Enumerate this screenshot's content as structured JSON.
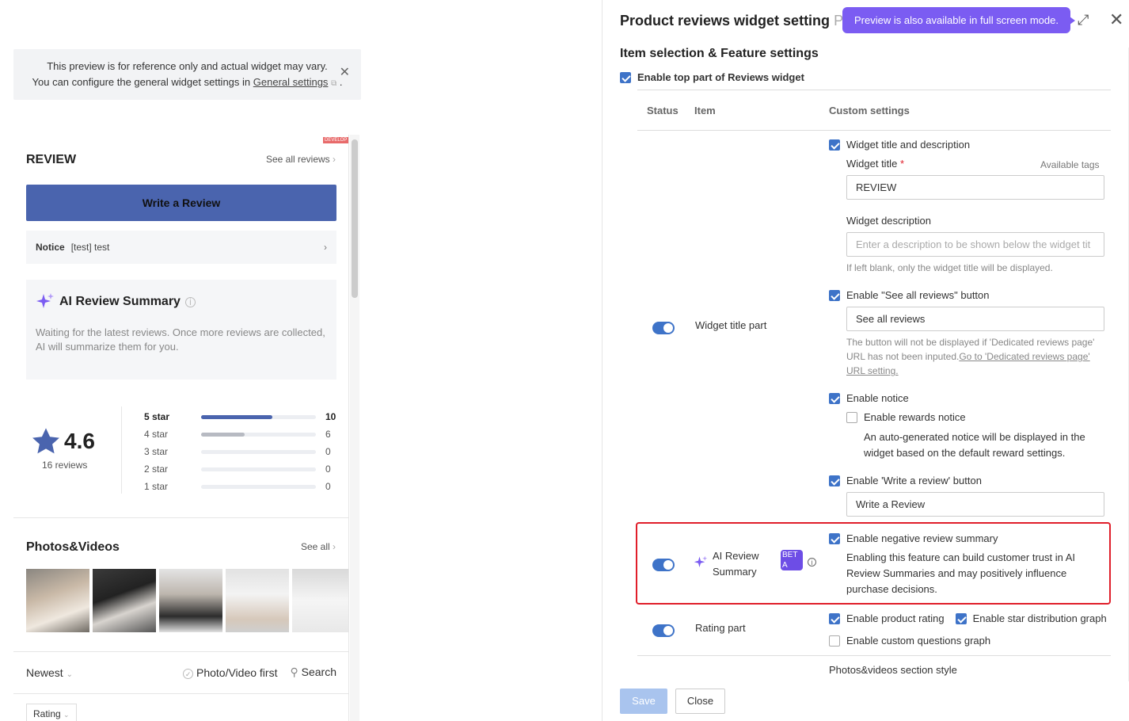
{
  "preview": {
    "notice_line1": "This preview is for reference only and actual widget may vary.",
    "notice_line2": "You can configure the general widget settings in",
    "notice_link": "General settings",
    "notice_end": ".",
    "dev_badge": "DEVELOP"
  },
  "widget": {
    "title": "REVIEW",
    "see_all": "See all reviews",
    "write_button": "Write a Review",
    "notice_label": "Notice",
    "notice_text": "[test] test",
    "ai_title": "AI Review Summary",
    "ai_text": "Waiting for the latest reviews. Once more reviews are collected, AI will summarize them for you.",
    "rating": "4.6",
    "reviews_count": "16 reviews",
    "distribution": [
      {
        "label": "5 star",
        "count": "10",
        "fraction": 0.62,
        "color": "#4a64ae",
        "bold": true
      },
      {
        "label": "4 star",
        "count": "6",
        "fraction": 0.38,
        "color": "#b7bac2",
        "bold": false
      },
      {
        "label": "3 star",
        "count": "0",
        "fraction": 0,
        "color": "#b7bac2",
        "bold": false
      },
      {
        "label": "2 star",
        "count": "0",
        "fraction": 0,
        "color": "#b7bac2",
        "bold": false
      },
      {
        "label": "1 star",
        "count": "0",
        "fraction": 0,
        "color": "#b7bac2",
        "bold": false
      }
    ],
    "photos_title": "Photos&Videos",
    "photos_see_all": "See all",
    "sort_label": "Newest",
    "photo_first": "Photo/Video first",
    "search": "Search",
    "rating_filter": "Rating"
  },
  "settings": {
    "title": "Product reviews widget setting",
    "tooltip": "Preview is also available in full screen mode.",
    "section_title": "Item selection & Feature settings",
    "enable_top": "Enable top part of Reviews widget",
    "col_status": "Status",
    "col_item": "Item",
    "col_custom": "Custom settings",
    "title_part": {
      "label": "Widget title part",
      "title_desc_chk": "Widget title and description",
      "widget_title_label": "Widget title",
      "required": "*",
      "available_tags": "Available tags",
      "widget_title_value": "REVIEW",
      "widget_desc_label": "Widget description",
      "widget_desc_placeholder": "Enter a description to be shown below the widget tit",
      "desc_hint": "If left blank, only the widget title will be displayed.",
      "see_all_chk": "Enable \"See all reviews\" button",
      "see_all_value": "See all reviews",
      "see_all_hint1": "The button will not be displayed if 'Dedicated reviews page'",
      "see_all_hint2": "URL has not been inputed.",
      "see_all_link1": "Go to 'Dedicated reviews page'",
      "see_all_link2": "URL setting.",
      "notice_chk": "Enable notice",
      "rewards_chk": "Enable rewards notice",
      "rewards_desc1": "An auto-generated notice will be displayed in the",
      "rewards_desc2": "widget based on the default reward settings.",
      "write_chk": "Enable 'Write a review' button",
      "write_value": "Write a Review"
    },
    "ai_part": {
      "label1": "AI Review",
      "label2": "Summary",
      "beta": "BETA",
      "neg_chk": "Enable negative review summary",
      "desc1": "Enabling this feature can build customer trust in AI",
      "desc2": "Review Summaries and may positively influence",
      "desc3": "purchase decisions."
    },
    "rating_part": {
      "label": "Rating part",
      "product_rating_chk": "Enable product rating",
      "star_dist_chk": "Enable star distribution graph",
      "custom_q_chk": "Enable custom questions graph"
    },
    "photos_style": "Photos&videos section style",
    "save": "Save",
    "close": "Close"
  }
}
